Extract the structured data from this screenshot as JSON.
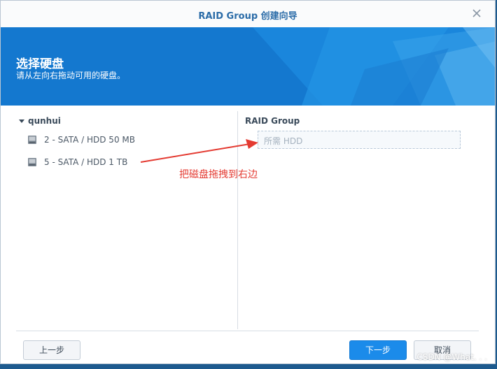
{
  "window": {
    "title": "RAID Group 创建向导",
    "close_icon": "close-icon"
  },
  "banner": {
    "title": "选择硬盘",
    "subtitle": "请从左向右拖动可用的硬盘。",
    "color": "#1478cf"
  },
  "left_pane": {
    "group_name": "qunhui",
    "disks": [
      {
        "label": "2 - SATA / HDD 50 MB",
        "icon": "hard-drive-icon"
      },
      {
        "label": "5 - SATA / HDD 1 TB",
        "icon": "hard-drive-icon"
      }
    ]
  },
  "right_pane": {
    "title": "RAID Group",
    "placeholder": "所需 HDD"
  },
  "annotation": {
    "text": "把磁盘拖拽到右边",
    "color": "#e43b32"
  },
  "footer": {
    "prev_label": "上一步",
    "next_label": "下一步",
    "cancel_label": "取消"
  },
  "watermark": "CSDN @What. . ."
}
